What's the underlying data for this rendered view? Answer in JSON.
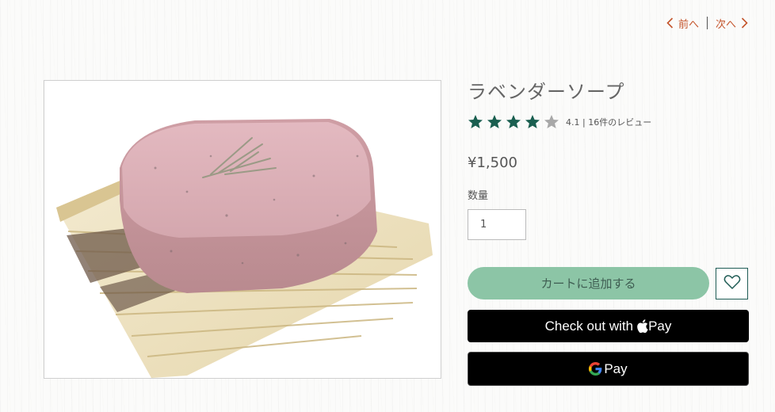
{
  "nav": {
    "prev_label": "前へ",
    "next_label": "次へ",
    "accent_color": "#c4552c"
  },
  "product": {
    "title": "ラベンダーソープ",
    "rating_value": 4.1,
    "stars_filled": 4,
    "stars_total": 5,
    "rating_text": "4.1 | 16件のレビュー",
    "price": "¥1,500",
    "image_icon": "lavender-soap-photo"
  },
  "quantity": {
    "label": "数量",
    "value": "1"
  },
  "actions": {
    "add_to_cart_label": "カートに追加する",
    "add_to_cart_color": "#8cc5a6",
    "wishlist_icon": "heart-icon",
    "apple_pay_prefix": "Check out with",
    "apple_pay_label": "Pay",
    "google_pay_label": "Pay"
  },
  "colors": {
    "star_filled": "#1a5f50",
    "star_empty": "#a8a8a8",
    "wishlist_border": "#1f5c55"
  }
}
